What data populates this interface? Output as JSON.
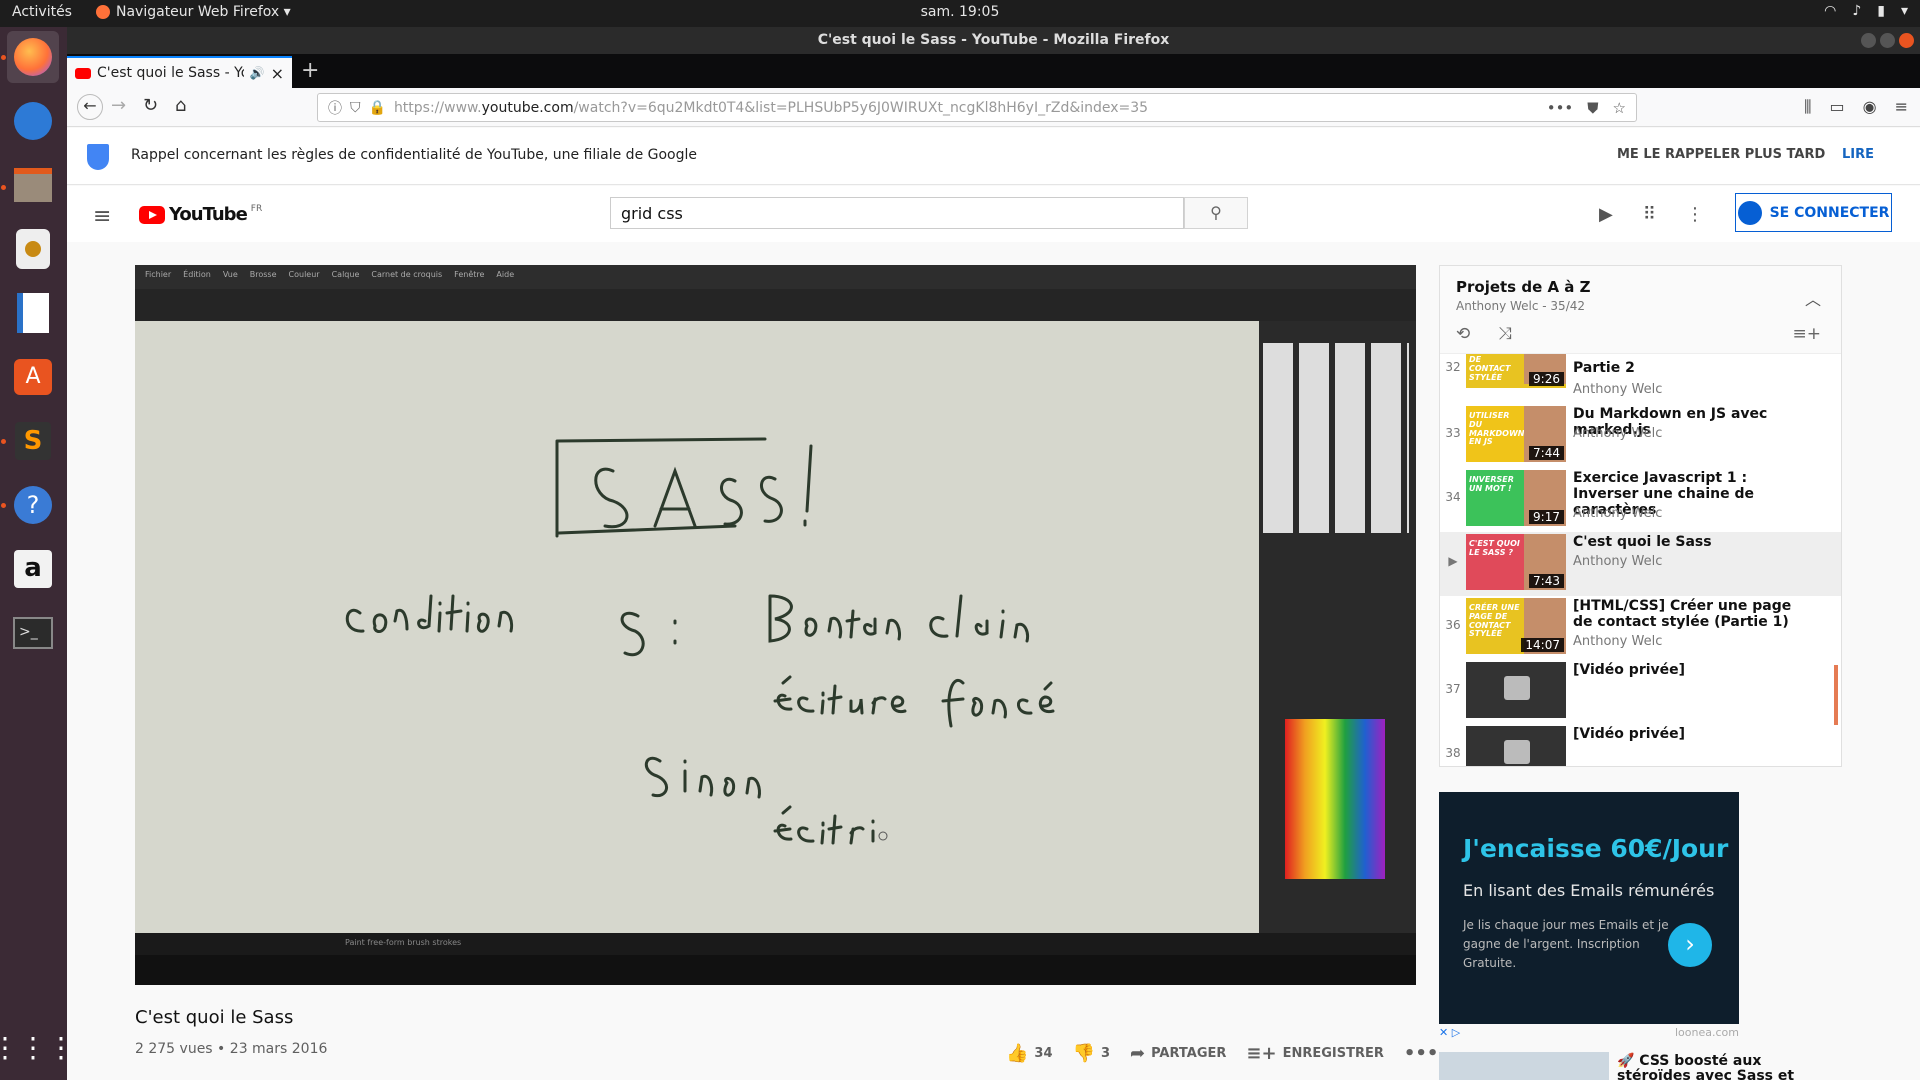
{
  "topbar": {
    "activities": "Activités",
    "app_menu": "Navigateur Web Firefox ▾",
    "clock": "sam. 19:05"
  },
  "window": {
    "title": "C'est quoi le Sass - YouTube - Mozilla Firefox"
  },
  "tab": {
    "title": "C'est quoi le Sass - You"
  },
  "navbar": {
    "url_host_prefix": "https://www.",
    "url_host": "youtube.com",
    "url_path": "/watch?v=6qu2Mkdt0T4&list=PLHSUbP5y6J0WIRUXt_ncgKl8hH6yI_rZd&index=35"
  },
  "privacy": {
    "message": "Rappel concernant les règles de confidentialité de YouTube, une filiale de Google",
    "later": "ME LE RAPPELER PLUS TARD",
    "read": "LIRE"
  },
  "header": {
    "logo_word": "YouTube",
    "region": "FR",
    "search_value": "grid css",
    "signin": "SE CONNECTER"
  },
  "video": {
    "title": "C'est quoi le Sass",
    "views": "2 275 vues",
    "date": "23 mars 2016",
    "likes": "34",
    "dislikes": "3",
    "share": "PARTAGER",
    "save": "ENREGISTRER",
    "app_menu": [
      "Fichier",
      "Édition",
      "Vue",
      "Brosse",
      "Couleur",
      "Calque",
      "Carnet de croquis",
      "Fenêtre",
      "Aide"
    ],
    "status_text": "Paint free-form brush strokes"
  },
  "playlist": {
    "title": "Projets de A à Z",
    "subtitle": "Anthony Welc - 35/42",
    "items": [
      {
        "num": "32",
        "title": "Partie 2",
        "author": "Anthony Welc",
        "dur": "9:26",
        "thumb_label": "DE CONTACT STYLÉE"
      },
      {
        "num": "33",
        "title": "Du Markdown en JS avec marked.js",
        "author": "Anthony Welc",
        "dur": "7:44",
        "thumb_label": "UTILISER DU MARKDOWN EN JS"
      },
      {
        "num": "34",
        "title": "Exercice Javascript 1 : Inverser une chaine de caractères",
        "author": "Anthony Welc",
        "dur": "9:17",
        "thumb_label": "INVERSER UN MOT !"
      },
      {
        "num": "▶",
        "title": "C'est quoi le Sass",
        "author": "Anthony Welc",
        "dur": "7:43",
        "thumb_label": "C'EST QUOI LE SASS ?"
      },
      {
        "num": "36",
        "title": "[HTML/CSS] Créer une page de contact stylée (Partie 1)",
        "author": "Anthony Welc",
        "dur": "14:07",
        "thumb_label": "CRÉER UNE PAGE DE CONTACT STYLÉE"
      },
      {
        "num": "37",
        "title": "[Vidéo privée]"
      },
      {
        "num": "38",
        "title": "[Vidéo privée]"
      }
    ]
  },
  "ad": {
    "headline": "J'encaisse 60€/Jour",
    "sub": "En lisant des Emails rémunérés",
    "body": "Je lis chaque jour mes Emails et je gagne de l'argent. Inscription Gratuite.",
    "source": "loonea.com"
  },
  "recommended": {
    "title": "🚀 CSS boosté aux stéroïdes avec Sass et SCSS"
  },
  "colors": {
    "accent": "#065fd4",
    "yt_red": "#ff0000",
    "ubuntu_orange": "#e95420"
  }
}
